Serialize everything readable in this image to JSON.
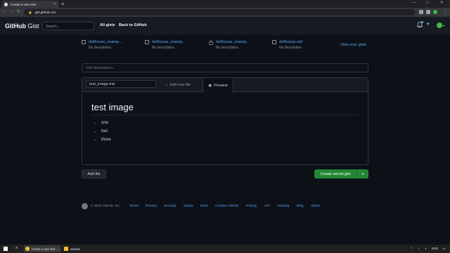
{
  "browser": {
    "tab_title": "Create a new Gist",
    "new_tab": "+",
    "url": "gist.github.com",
    "window_controls": [
      "—",
      "□",
      "✕"
    ]
  },
  "header": {
    "logo_main": "GitHub",
    "logo_sub": "Gist",
    "search_placeholder": "Search...",
    "links": [
      "All gists",
      "Back to GitHub"
    ]
  },
  "gists": [
    {
      "name": "dollhouse_examp...",
      "desc": "No description.",
      "icon": "code-file-icon"
    },
    {
      "name": "dollhouse_examp...",
      "desc": "No description.",
      "icon": "code-file-icon"
    },
    {
      "name": "dollhouse_examp...",
      "desc": "No description.",
      "icon": "lock-icon"
    },
    {
      "name": "dollhouse.md",
      "desc": "No description.",
      "icon": "code-file-icon"
    }
  ],
  "view_your_gists": "View your gists",
  "form": {
    "description_placeholder": "Gist description...",
    "filename": "test_image.md",
    "tab_edit": "Edit new file",
    "tab_preview": "Preview",
    "preview_heading": "test image",
    "preview_items": [
      "one",
      "two",
      "three"
    ],
    "add_file": "Add file",
    "create_button": "Create secret gist"
  },
  "footer": {
    "copyright": "© 2022 GitHub, Inc.",
    "links": [
      "Terms",
      "Privacy",
      "Security",
      "Status",
      "Docs",
      "Contact GitHub",
      "Pricing",
      "API",
      "Training",
      "Blog",
      "About"
    ]
  },
  "taskbar": {
    "chrome_label": "Create a new Gist - ...",
    "explorer_label": "window",
    "lang": "ENG"
  },
  "colors": {
    "bg": "#0d1117",
    "header": "#161b22",
    "link": "#58a6ff",
    "primary": "#238636"
  }
}
